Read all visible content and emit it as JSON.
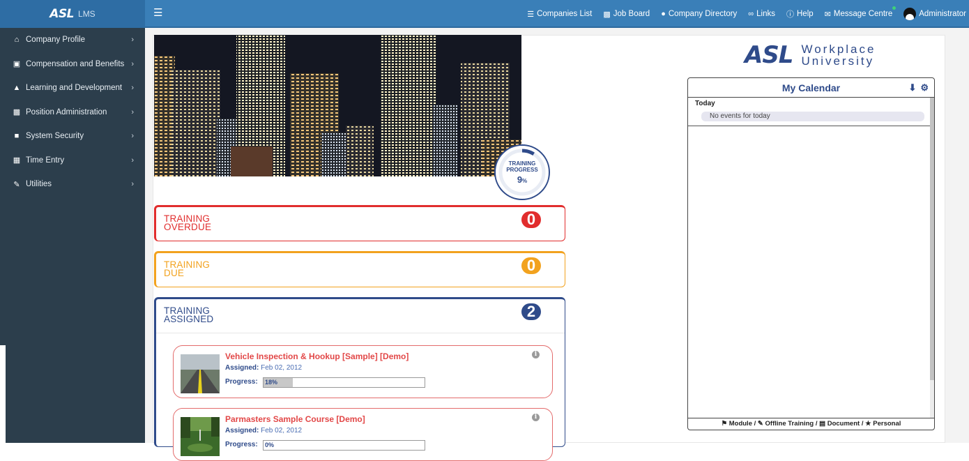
{
  "brand": {
    "logo": "ASL",
    "sub": "LMS"
  },
  "topnav": {
    "companies_list": "Companies List",
    "job_board": "Job Board",
    "company_directory": "Company Directory",
    "links": "Links",
    "help": "Help",
    "message_centre": "Message Centre",
    "user": "Administrator"
  },
  "sidebar": {
    "items": [
      {
        "label": "Company Profile",
        "icon": "bank-icon"
      },
      {
        "label": "Compensation and Benefits",
        "icon": "money-icon"
      },
      {
        "label": "Learning and Development",
        "icon": "graduation-cap-icon"
      },
      {
        "label": "Position Administration",
        "icon": "org-chart-icon"
      },
      {
        "label": "System Security",
        "icon": "lock-icon"
      },
      {
        "label": "Time Entry",
        "icon": "calendar-icon"
      },
      {
        "label": "Utilities",
        "icon": "wrench-icon"
      }
    ]
  },
  "progress": {
    "title_line1": "TRAINING",
    "title_line2": "PROGRESS",
    "value": "9",
    "unit": "%",
    "fraction": 0.09
  },
  "training": {
    "overdue": {
      "line1": "TRAINING",
      "line2": "OVERDUE",
      "count": "0"
    },
    "due": {
      "line1": "TRAINING",
      "line2": "DUE",
      "count": "0"
    },
    "assigned": {
      "line1": "TRAINING",
      "line2": "ASSIGNED",
      "count": "2"
    }
  },
  "courses": [
    {
      "title": "Vehicle Inspection & Hookup [Sample] [Demo]",
      "assigned_label": "Assigned:",
      "assigned": "Feb 02, 2012",
      "progress_label": "Progress:",
      "progress": "18%",
      "progress_fraction": 0.18
    },
    {
      "title": "Parmasters Sample Course [Demo]",
      "assigned_label": "Assigned:",
      "assigned": "Feb 02, 2012",
      "progress_label": "Progress:",
      "progress": "0%",
      "progress_fraction": 0.0
    }
  ],
  "wu_logo": {
    "mark": "ASL",
    "line1": "Workplace",
    "line2": "University"
  },
  "calendar": {
    "title": "My Calendar",
    "today_label": "Today",
    "no_events": "No events for today",
    "legend": "Module / Offline Training / Document / Personal",
    "legend_module": "Module",
    "legend_offline": "Offline Training",
    "legend_document": "Document",
    "legend_personal": "Personal"
  },
  "colors": {
    "accent": "#2f4b8a",
    "overdue": "#e12d2d",
    "due": "#f2a21e",
    "topbar": "#3a7fb8",
    "sidebar": "#2c3e4c"
  }
}
